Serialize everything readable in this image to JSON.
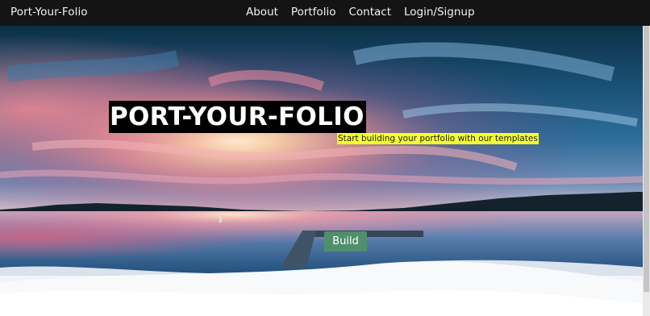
{
  "navbar": {
    "brand": "Port-Your-Folio",
    "links": [
      {
        "label": "About"
      },
      {
        "label": "Portfolio"
      },
      {
        "label": "Contact"
      },
      {
        "label": "Login/Signup"
      }
    ],
    "background": "#141414"
  },
  "hero": {
    "title": "PORT-YOUR-FOLIO",
    "subtitle": "Start building your portfolio with our templates",
    "build_label": "Build",
    "colors": {
      "title_bg": "#000000",
      "subtitle_highlight": "#f5ff2e",
      "button": "#4f8f6b"
    }
  }
}
